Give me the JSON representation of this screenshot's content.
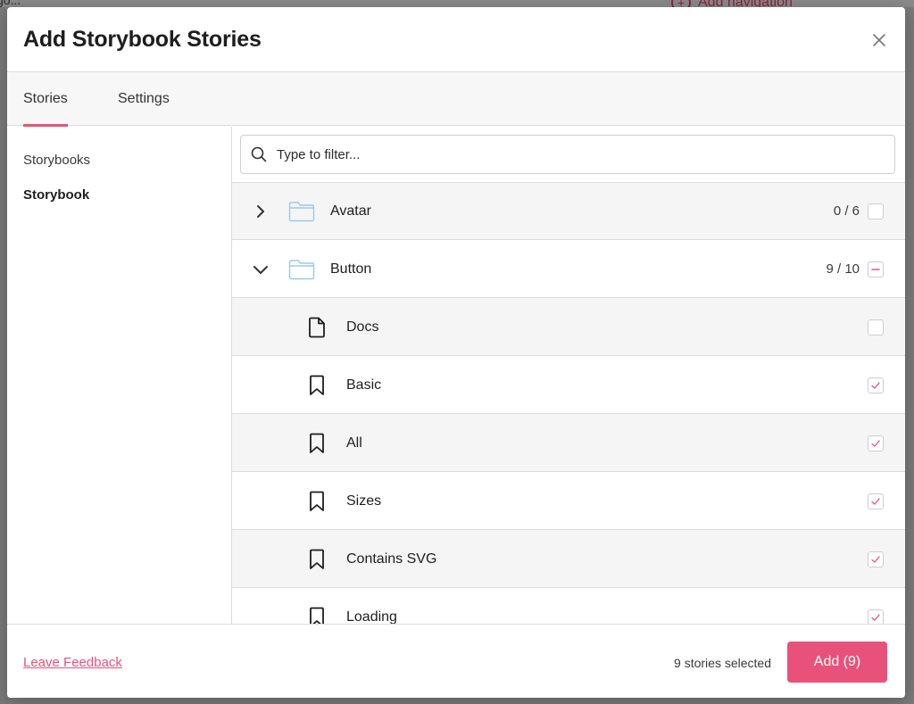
{
  "background": {
    "loading_text": "go...",
    "add_navigation_label": "Add navigation"
  },
  "modal": {
    "title": "Add Storybook Stories",
    "close_icon": "close-icon"
  },
  "tabs": [
    {
      "label": "Stories",
      "active": true
    },
    {
      "label": "Settings",
      "active": false
    }
  ],
  "sidebar": {
    "items": [
      {
        "label": "Storybooks",
        "active": false
      },
      {
        "label": "Storybook",
        "active": true
      }
    ]
  },
  "filter": {
    "placeholder": "Type to filter...",
    "value": ""
  },
  "groups": [
    {
      "label": "Avatar",
      "count": "0 / 6",
      "expanded": false,
      "state": "unchecked"
    },
    {
      "label": "Button",
      "count": "9 / 10",
      "expanded": true,
      "state": "indeterminate"
    }
  ],
  "stories": [
    {
      "label": "Docs",
      "icon": "document-icon",
      "checked": false
    },
    {
      "label": "Basic",
      "icon": "bookmark-icon",
      "checked": true
    },
    {
      "label": "All",
      "icon": "bookmark-icon",
      "checked": true
    },
    {
      "label": "Sizes",
      "icon": "bookmark-icon",
      "checked": true
    },
    {
      "label": "Contains SVG",
      "icon": "bookmark-icon",
      "checked": true
    },
    {
      "label": "Loading",
      "icon": "bookmark-icon",
      "checked": true
    }
  ],
  "footer": {
    "feedback_label": "Leave Feedback",
    "selected_text": "9 stories selected",
    "add_label": "Add (9)"
  },
  "colors": {
    "accent": "#e8527a",
    "folder": "#9cc8e8",
    "row_shade": "#f5f5f5"
  }
}
